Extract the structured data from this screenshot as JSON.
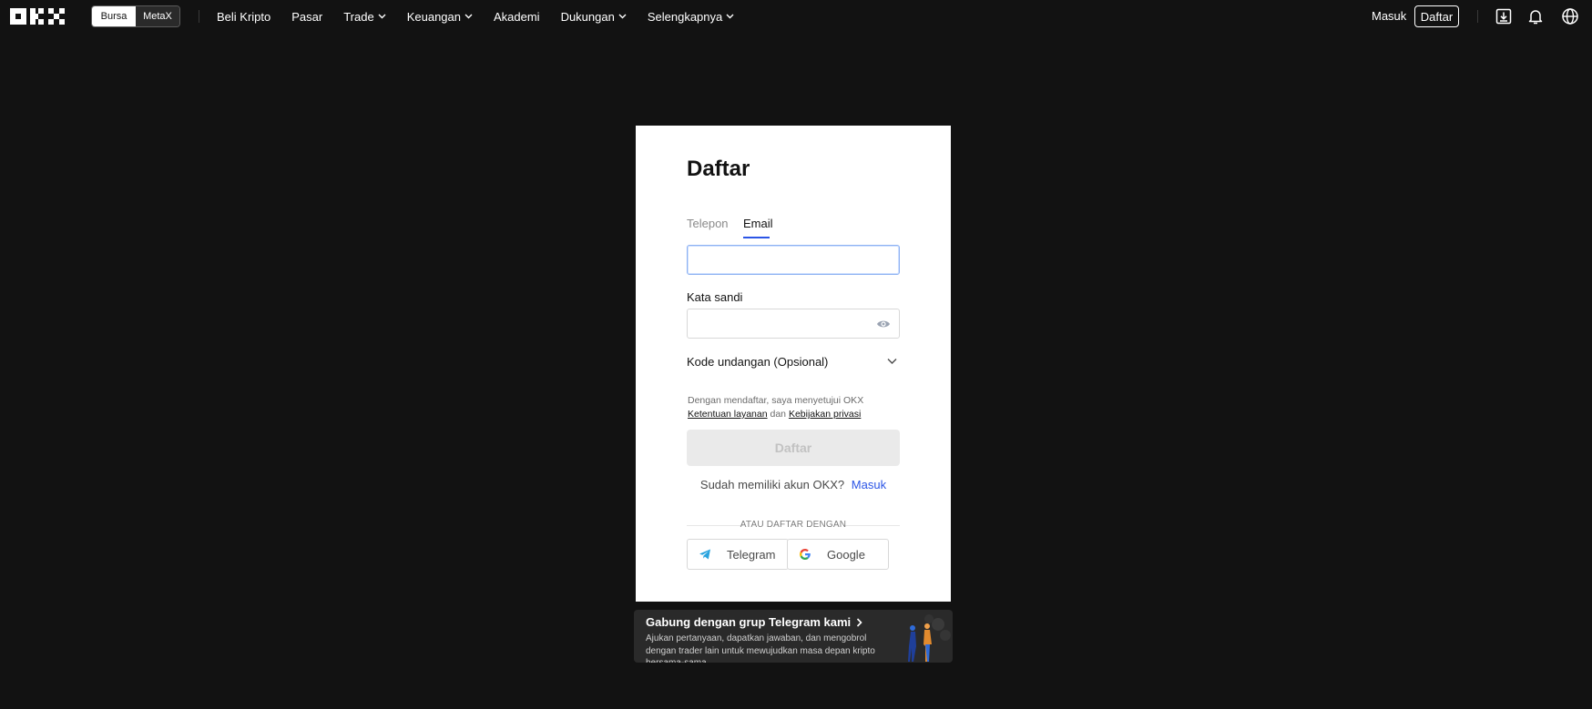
{
  "nav": {
    "mode_tabs": [
      {
        "label": "Bursa",
        "active": true
      },
      {
        "label": "MetaX",
        "active": false
      }
    ],
    "menu": [
      {
        "label": "Beli Kripto",
        "dropdown": false
      },
      {
        "label": "Pasar",
        "dropdown": false
      },
      {
        "label": "Trade",
        "dropdown": true
      },
      {
        "label": "Keuangan",
        "dropdown": true
      },
      {
        "label": "Akademi",
        "dropdown": false
      },
      {
        "label": "Dukungan",
        "dropdown": true
      },
      {
        "label": "Selengkapnya",
        "dropdown": true
      }
    ],
    "login_label": "Masuk",
    "signup_label": "Daftar",
    "icons": [
      "download-icon",
      "bell-icon",
      "globe-icon"
    ]
  },
  "form": {
    "title": "Daftar",
    "tabs": [
      {
        "label": "Telepon",
        "active": false
      },
      {
        "label": "Email",
        "active": true
      }
    ],
    "email": {
      "value": "",
      "placeholder": ""
    },
    "password": {
      "label": "Kata sandi",
      "value": "",
      "placeholder": ""
    },
    "invite_label": "Kode undangan (Opsional)",
    "terms": {
      "prefix": "Dengan mendaftar, saya menyetujui OKX",
      "tos_link": "Ketentuan layanan",
      "and": "dan",
      "privacy_link": "Kebijakan privasi"
    },
    "submit_label": "Daftar",
    "have_account": "Sudah memiliki akun OKX?",
    "login_link": "Masuk",
    "divider": "ATAU DAFTAR DENGAN",
    "social": [
      {
        "label": "Telegram",
        "icon": "telegram-icon"
      },
      {
        "label": "Google",
        "icon": "google-icon"
      }
    ]
  },
  "banner": {
    "title": "Gabung dengan grup Telegram kami",
    "description": "Ajukan pertanyaan, dapatkan jawaban, dan mengobrol dengan trader lain untuk mewujudkan masa depan kripto bersama-sama"
  },
  "colors": {
    "background": "#121212",
    "card": "#ffffff",
    "accent": "#2b55e6",
    "banner": "#2a2a2a"
  }
}
